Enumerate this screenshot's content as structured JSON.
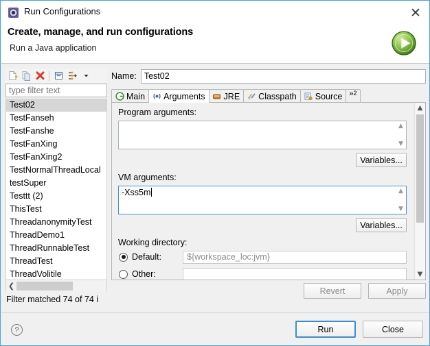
{
  "window": {
    "title": "Run Configurations",
    "icon": "run-configurations-icon",
    "close_label": "✕"
  },
  "header": {
    "title": "Create, manage, and run configurations",
    "subtitle": "Run a Java application",
    "badge_icon": "green-run-play-icon"
  },
  "left_panel": {
    "toolbar": [
      {
        "name": "new-configuration-icon",
        "label": "New launch configuration"
      },
      {
        "name": "duplicate-configuration-icon",
        "label": "Duplicate"
      },
      {
        "name": "delete-configuration-icon",
        "label": "Delete"
      },
      {
        "name": "collapse-all-icon",
        "label": "Collapse All"
      },
      {
        "name": "filter-configurations-icon",
        "label": "Filter launch configurations"
      },
      {
        "name": "chevron-down-icon",
        "label": "View Menu"
      }
    ],
    "filter": {
      "placeholder": "type filter text",
      "value": ""
    },
    "items": [
      {
        "label": "Test02",
        "selected": true
      },
      {
        "label": "TestFanseh",
        "selected": false
      },
      {
        "label": "TestFanshe",
        "selected": false
      },
      {
        "label": "TestFanXing",
        "selected": false
      },
      {
        "label": "TestFanXing2",
        "selected": false
      },
      {
        "label": "TestNormalThreadLocal",
        "selected": false
      },
      {
        "label": "testSuper",
        "selected": false
      },
      {
        "label": "Testtt (2)",
        "selected": false
      },
      {
        "label": "ThisTest",
        "selected": false
      },
      {
        "label": "ThreadanonymityTest",
        "selected": false
      },
      {
        "label": "ThreadDemo1",
        "selected": false
      },
      {
        "label": "ThreadRunnableTest",
        "selected": false
      },
      {
        "label": "ThreadTest",
        "selected": false
      },
      {
        "label": "ThreadVolitile",
        "selected": false
      }
    ],
    "status": "Filter matched 74 of 74 i"
  },
  "right_panel": {
    "name_label": "Name:",
    "name_value": "Test02",
    "tabs": [
      {
        "label": "Main",
        "icon": "main-tab-icon",
        "active": false
      },
      {
        "label": "Arguments",
        "icon": "arguments-tab-icon",
        "active": true
      },
      {
        "label": "JRE",
        "icon": "jre-tab-icon",
        "active": false
      },
      {
        "label": "Classpath",
        "icon": "classpath-tab-icon",
        "active": false
      },
      {
        "label": "Source",
        "icon": "source-tab-icon",
        "active": false
      }
    ],
    "tab_overflow": {
      "symbol": "»",
      "count": "2"
    },
    "arguments_tab": {
      "program_arguments_label": "Program arguments:",
      "program_arguments_value": "",
      "program_variables_button": "Variables...",
      "vm_arguments_label": "VM arguments:",
      "vm_arguments_value": "-Xss5m",
      "vm_variables_button": "Variables...",
      "working_directory_label": "Working directory:",
      "default_radio_label": "Default:",
      "default_radio_checked": true,
      "default_value": "${workspace_loc:jvm}",
      "other_radio_label": "Other:",
      "other_radio_checked": false,
      "other_value": ""
    },
    "revert_button": "Revert",
    "apply_button": "Apply"
  },
  "footer": {
    "help_icon": "help-question-icon",
    "help_label": "?",
    "run_button": "Run",
    "close_button": "Close"
  },
  "colors": {
    "accent": "#4aa3d8",
    "default_button_border": "#3c8ecb",
    "focus_border": "#4a90c4",
    "selection": "#d6d6d6",
    "run_green": "#5aa832",
    "delete_red": "#d63c2e"
  }
}
